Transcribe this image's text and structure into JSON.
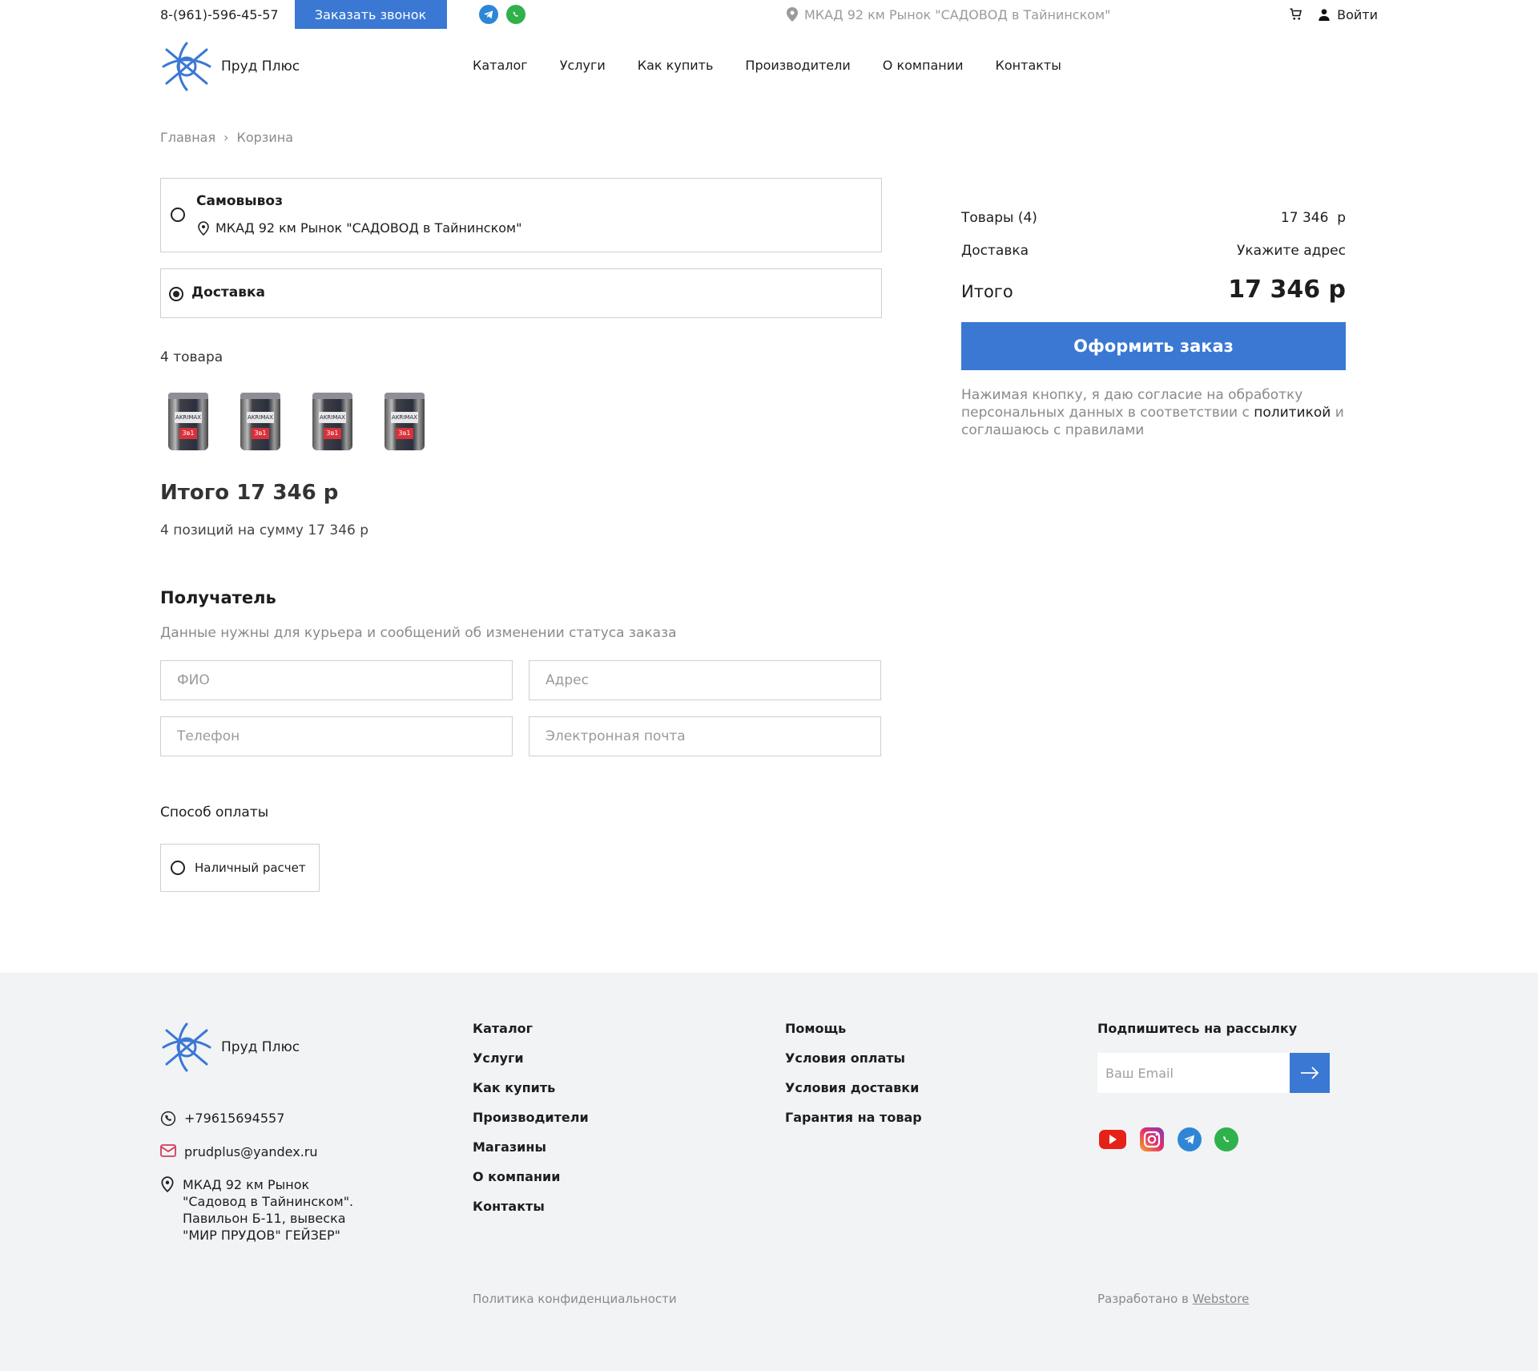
{
  "topbar": {
    "phone": "8-(961)-596-45-57",
    "call_button": "Заказать звонок",
    "address": "МКАД 92 км Рынок \"САДОВОД в Тайнинском\"",
    "login": "Войти"
  },
  "header": {
    "brand": "Пруд Плюс",
    "nav": [
      "Каталог",
      "Услуги",
      "Как купить",
      "Производители",
      "О компании",
      "Контакты"
    ]
  },
  "breadcrumbs": [
    "Главная",
    "Корзина"
  ],
  "delivery": {
    "pickup_title": "Самовывоз",
    "pickup_address": "МКАД 92 км Рынок \"САДОВОД в Тайнинском\"",
    "delivery_title": "Доставка",
    "selected": "Доставка"
  },
  "cart": {
    "count_label": "4 товара",
    "product_label": "AKRIMAX",
    "product_sub": "3в1",
    "total_title": "Итого 17 346 р",
    "total_sub": "4 позиций на сумму 17 346 р"
  },
  "recipient": {
    "title": "Получатель",
    "subtitle": "Данные нужны для курьера и сообщений об изменении статуса заказа",
    "fio_placeholder": "ФИО",
    "address_placeholder": "Адрес",
    "phone_placeholder": "Телефон",
    "email_placeholder": "Электронная почта"
  },
  "payment": {
    "title": "Способ оплаты",
    "option": "Наличный расчет"
  },
  "summary": {
    "goods_label": "Товары (4)",
    "goods_value": "17 346  р",
    "delivery_label": "Доставка",
    "delivery_value": "Укажите адрес",
    "total_label": "Итого",
    "total_value": "17 346 р",
    "order_button": "Оформить заказ",
    "consent_1": "Нажимая кнопку, я даю согласие на обработку персональных данных в соответствии с ",
    "consent_link": "политикой",
    "consent_2": " и соглашаюсь с правилами"
  },
  "footer": {
    "brand": "Пруд Плюс",
    "phone": "+79615694557",
    "email": "prudplus@yandex.ru",
    "address": "МКАД 92 км Рынок \"Садовод в Тайнинском\". Павильон Б-11, вывеска \"МИР ПРУДОВ\" ГЕЙЗЕР\"",
    "col1": [
      "Каталог",
      "Услуги",
      "Как купить",
      "Производители",
      "Магазины",
      "О компании",
      "Контакты"
    ],
    "col2": [
      "Помощь",
      "Условия оплаты",
      "Условия доставки",
      "Гарантия на товар"
    ],
    "subscribe_title": "Подпишитесь на рассылку",
    "email_placeholder": "Ваш Email",
    "privacy": "Политика конфиденциальности",
    "dev_prefix": "Разработано в ",
    "dev_link": "Webstore"
  },
  "colors": {
    "accent": "#3a78d4",
    "youtube": "#e62117",
    "telegram": "#2f86d6",
    "whatsapp": "#2fb14b"
  }
}
